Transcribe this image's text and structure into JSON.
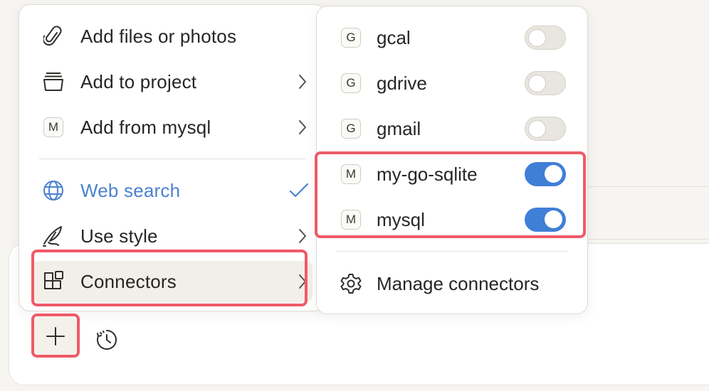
{
  "main_menu": {
    "items": [
      {
        "label": "Add files or photos",
        "icon": "paperclip-icon"
      },
      {
        "label": "Add to project",
        "icon": "project-box-icon"
      },
      {
        "label": "Add from mysql",
        "icon": "m-badge-icon",
        "badge": "M"
      },
      {
        "label": "Web search",
        "icon": "globe-icon",
        "checked": true
      },
      {
        "label": "Use style",
        "icon": "quill-icon"
      },
      {
        "label": "Connectors",
        "icon": "connectors-icon"
      }
    ]
  },
  "sub_menu": {
    "connectors": [
      {
        "label": "gcal",
        "badge": "G",
        "enabled": false
      },
      {
        "label": "gdrive",
        "badge": "G",
        "enabled": false
      },
      {
        "label": "gmail",
        "badge": "G",
        "enabled": false
      },
      {
        "label": "my-go-sqlite",
        "badge": "M",
        "enabled": true
      },
      {
        "label": "mysql",
        "badge": "M",
        "enabled": true
      }
    ],
    "manage_label": "Manage connectors"
  },
  "colors": {
    "accent": "#3f7fd6",
    "web_search": "#4a82cf",
    "highlight": "#ef5a68"
  }
}
